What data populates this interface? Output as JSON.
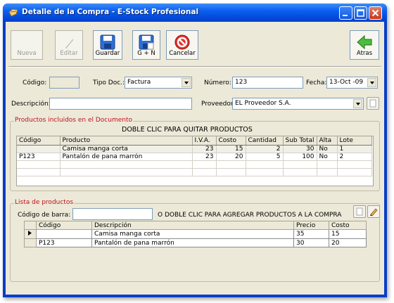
{
  "window": {
    "title": "Detalle de la Compra - E-Stock Profesional"
  },
  "toolbar": {
    "nueva": "Nueva",
    "editar": "Editar",
    "guardar": "Guardar",
    "guardar_nueva": "G + N",
    "cancelar": "Cancelar",
    "atras": "Atras"
  },
  "form": {
    "codigo_label": "Código:",
    "codigo_value": "",
    "tipo_doc_label": "Tipo Doc.:",
    "tipo_doc_value": "Factura",
    "numero_label": "Número:",
    "numero_value": "123",
    "fecha_label": "Fecha:",
    "fecha_value": "13-Oct -09",
    "descripcion_label": "Descripción:",
    "descripcion_value": "",
    "proveedor_label": "Proveedor:",
    "proveedor_value": "EL Proveedor S.A."
  },
  "included": {
    "legend": "Productos incluidos en el Documento",
    "hint": "DOBLE CLIC PARA QUITAR PRODUCTOS",
    "columns": [
      "Código",
      "Producto",
      "I.V.A.",
      "Costo",
      "Cantidad",
      "Sub Total",
      "Alta",
      "Lote"
    ],
    "rows": [
      {
        "codigo": "",
        "producto": "Camisa manga corta",
        "iva": "23",
        "costo": "15",
        "cantidad": "2",
        "subtotal": "30",
        "alta": "No",
        "lote": "1"
      },
      {
        "codigo": "P123",
        "producto": "Pantalón de pana marrón",
        "iva": "23",
        "costo": "20",
        "cantidad": "5",
        "subtotal": "100",
        "alta": "No",
        "lote": "2"
      }
    ]
  },
  "product_list": {
    "legend": "Lista de productos",
    "barcode_label": "Código de barra:",
    "barcode_value": "",
    "hint": "O DOBLE CLIC PARA AGREGAR PRODUCTOS A LA COMPRA",
    "columns": [
      "Código",
      "Descripción",
      "Precio",
      "Costo"
    ],
    "rows": [
      {
        "selected": true,
        "codigo": "",
        "descripcion": "Camisa manga corta",
        "precio": "35",
        "costo": "15"
      },
      {
        "selected": false,
        "codigo": "P123",
        "descripcion": "Pantalón de pana marrón",
        "precio": "30",
        "costo": "20"
      }
    ]
  }
}
